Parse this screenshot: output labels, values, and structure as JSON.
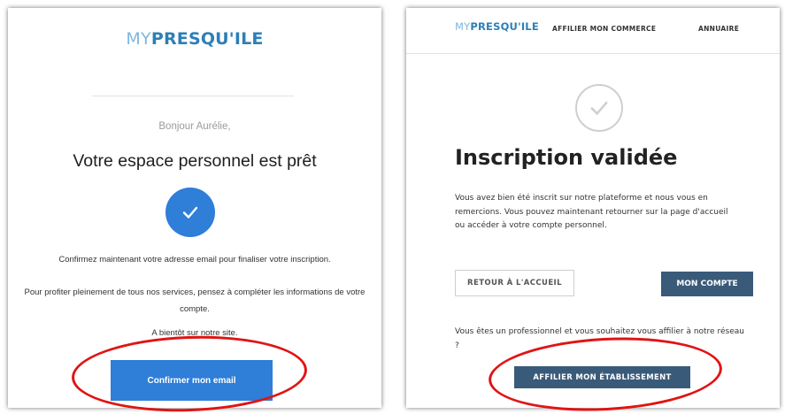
{
  "colors": {
    "logo_light": "#7fb8de",
    "logo_dark": "#2d7fb6",
    "primary_blue": "#2f7ed8",
    "navy_button": "#3a5a7a",
    "annotation_red": "#e01414"
  },
  "email": {
    "logo_my": "MY",
    "logo_rest": "PRESQU'ILE",
    "greeting": "Bonjour Aurélie,",
    "heading": "Votre espace personnel est prêt",
    "check_icon": "check-circle-icon",
    "confirm_text": "Confirmez maintenant votre adresse email pour finaliser votre inscription.",
    "profit_text": "Pour profiter pleinement de tous nos services, pensez à compléter les informations de votre compte.",
    "bye_text": "A bientôt sur notre site.",
    "confirm_button": "Confirmer mon email"
  },
  "site": {
    "logo_my": "MY",
    "logo_rest": "PRESQU'ILE",
    "nav": {
      "affilier": "AFFILIER MON COMMERCE",
      "annuaire": "ANNUAIRE"
    },
    "check_icon": "check-circle-outline-icon",
    "heading": "Inscription validée",
    "body": "Vous avez bien été inscrit sur notre plateforme et nous vous en remercions. Vous pouvez maintenant retourner sur la page d'accueil ou accéder à votre compte personnel.",
    "retour_button": "RETOUR À L'ACCUEIL",
    "account_button": "MON COMPTE",
    "pro_text": "Vous êtes un professionnel et vous souhaitez vous affilier à notre réseau ?",
    "affilier_button": "AFFILIER MON ÉTABLISSEMENT"
  }
}
